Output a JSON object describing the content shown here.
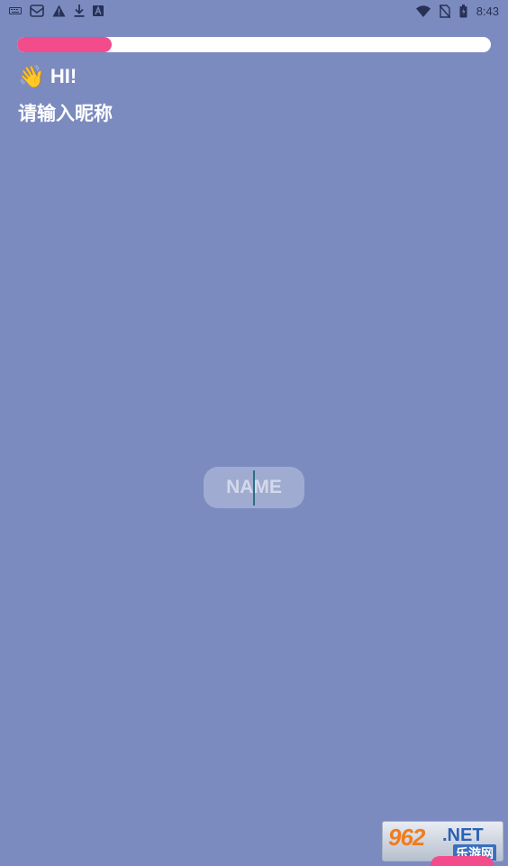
{
  "status_bar": {
    "time": "8:43",
    "left_icons": [
      "keyboard-icon",
      "mailbox-icon",
      "warning-icon",
      "download-icon",
      "font-icon"
    ],
    "right_icons": [
      "wifi-icon",
      "no-sim-icon",
      "battery-icon"
    ]
  },
  "progress": {
    "value": 0.2,
    "fill_color": "#f24c8c",
    "track_color": "#ffffff"
  },
  "greeting": {
    "emoji": "👋",
    "text": "HI!"
  },
  "subtitle": "请输入昵称",
  "name_input": {
    "placeholder": "NAME",
    "value": ""
  },
  "watermark": {
    "number": "962",
    "suffix": ".NET",
    "label": "乐游网"
  },
  "colors": {
    "background": "#7b8bbf",
    "accent": "#f24c8c"
  }
}
